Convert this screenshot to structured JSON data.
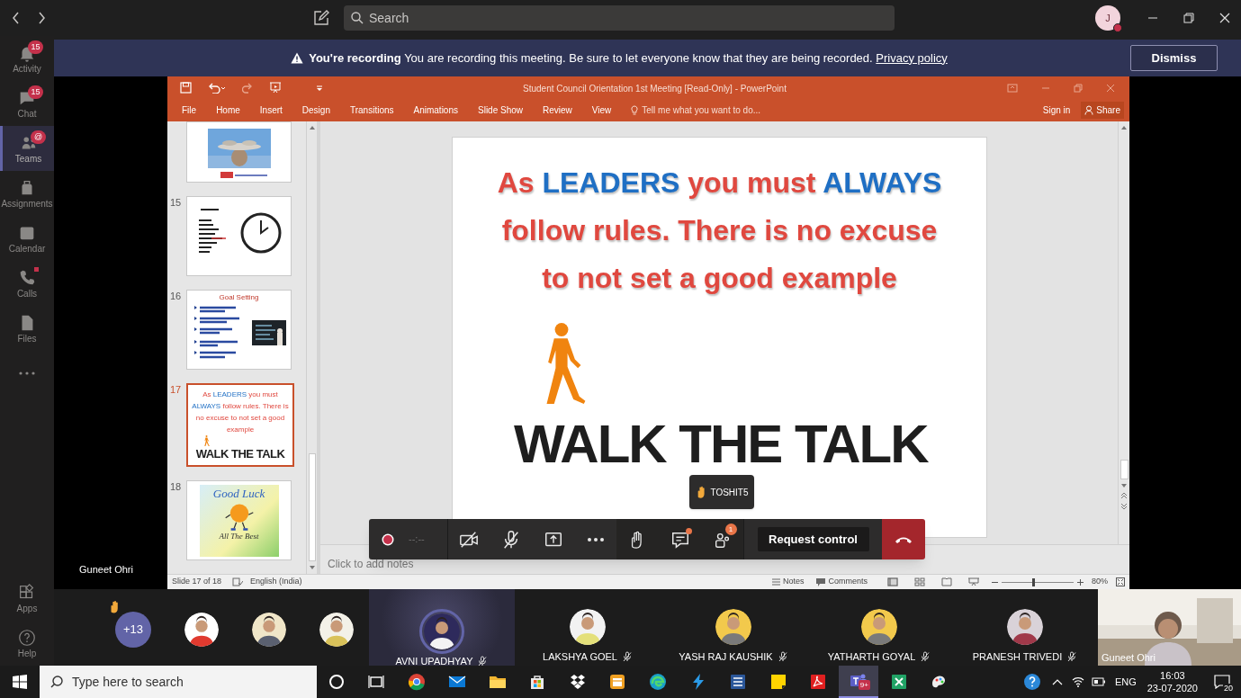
{
  "top_bar": {
    "search_placeholder": "Search",
    "account_initial": "J"
  },
  "app_bar": [
    {
      "kind": "activity",
      "label": "Activity",
      "badge": "15",
      "selected": false,
      "dot": false
    },
    {
      "kind": "chat",
      "label": "Chat",
      "badge": "15",
      "selected": false,
      "dot": false
    },
    {
      "kind": "teams",
      "label": "Teams",
      "badge": "@",
      "selected": true,
      "dot": false
    },
    {
      "kind": "assignments",
      "label": "Assignments",
      "selected": false,
      "dot": false
    },
    {
      "kind": "calendar",
      "label": "Calendar",
      "selected": false,
      "dot": false
    },
    {
      "kind": "calls",
      "label": "Calls",
      "selected": false,
      "dot": true
    },
    {
      "kind": "files",
      "label": "Files",
      "selected": false,
      "dot": false
    }
  ],
  "app_bar_bottom": [
    {
      "kind": "apps",
      "label": "Apps"
    },
    {
      "kind": "help",
      "label": "Help"
    }
  ],
  "banner": {
    "title": "You're recording",
    "message": "You are recording this meeting. Be sure to let everyone know that they are being recorded.",
    "link": "Privacy policy",
    "button": "Dismiss"
  },
  "powerpoint": {
    "title": "Student Council Orientation 1st Meeting [Read-Only] - PowerPoint",
    "ribbon_tabs": [
      "File",
      "Home",
      "Insert",
      "Design",
      "Transitions",
      "Animations",
      "Slide Show",
      "Review",
      "View"
    ],
    "tell_me": "Tell me what you want to do...",
    "sign_in": "Sign in",
    "share": "Share",
    "thumbnails": [
      {
        "kind": "picture",
        "selected": false
      },
      {
        "kind": "clock",
        "number": "15",
        "selected": false
      },
      {
        "kind": "bullets",
        "number": "16",
        "title": "Goal Setting",
        "selected": false
      },
      {
        "kind": "headline",
        "number": "17",
        "segments": [
          {
            "text": "As ",
            "emphasis": false
          },
          {
            "text": "LEADERS",
            "emphasis": true
          },
          {
            "text": " you must ",
            "emphasis": false
          },
          {
            "text": "ALWAYS",
            "emphasis": true
          },
          {
            "text": " follow rules. There is no excuse to not set a good example",
            "emphasis": false
          }
        ],
        "footer": "WALK THE TALK",
        "selected": true
      },
      {
        "kind": "good_luck",
        "number": "18",
        "title": "Good Luck",
        "caption": "All The Best",
        "selected": false
      }
    ],
    "slide": {
      "segments": [
        {
          "text": "As ",
          "emphasis": false
        },
        {
          "text": "LEADERS",
          "emphasis": true
        },
        {
          "text": " you must ",
          "emphasis": false
        },
        {
          "text": "ALWAYS",
          "emphasis": true
        },
        {
          "text": " follow rules. There is no excuse to not set a good example",
          "emphasis": false
        }
      ],
      "footer": "WALK THE TALK"
    },
    "notes_placeholder": "Click to add notes",
    "status": {
      "slide": "Slide 17 of 18",
      "language": "English (India)",
      "notes": "Notes",
      "comments": "Comments",
      "zoom": "80%",
      "level": 0.42
    }
  },
  "presenter_label": "Guneet Ohri",
  "tooltip": {
    "name": "TOSHIT5"
  },
  "call_controls": {
    "timer": "--:--",
    "chat_unread": true,
    "participants_badge": "1",
    "request_control": "Request control"
  },
  "participants": {
    "overflow": "+13",
    "hand_raised": true,
    "avatars": [
      {
        "kind": "picture"
      },
      {
        "kind": "picture"
      },
      {
        "kind": "picture"
      }
    ],
    "tiles": [
      {
        "name": "AVNI UPADHYAY",
        "muted": true,
        "speaking": true
      },
      {
        "name": "LAKSHYA GOEL",
        "muted": true,
        "speaking": false
      },
      {
        "name": "YASH RAJ KAUSHIK",
        "muted": true,
        "speaking": false
      },
      {
        "name": "YATHARTH GOYAL",
        "muted": true,
        "speaking": false
      },
      {
        "name": "PRANESH TRIVEDI",
        "muted": true,
        "speaking": false
      }
    ],
    "self_view": {
      "name": "Guneet Ohri"
    }
  },
  "taskbar": {
    "search_placeholder": "Type here to search",
    "apps": [
      {
        "kind": "cortana",
        "active": false
      },
      {
        "kind": "task_view",
        "active": false
      },
      {
        "kind": "chrome",
        "active": false
      },
      {
        "kind": "mail",
        "active": false
      },
      {
        "kind": "explorer",
        "active": false
      },
      {
        "kind": "store",
        "active": false
      },
      {
        "kind": "dropbox",
        "active": false
      },
      {
        "kind": "office",
        "active": false
      },
      {
        "kind": "edge",
        "active": false
      },
      {
        "kind": "bolt",
        "active": false
      },
      {
        "kind": "word",
        "active": false
      },
      {
        "kind": "sticky_notes",
        "active": false
      },
      {
        "kind": "acrobat",
        "active": false
      },
      {
        "kind": "teams",
        "badge": "9+",
        "active": true
      },
      {
        "kind": "excel",
        "active": false
      },
      {
        "kind": "paint",
        "active": false
      }
    ],
    "language": "ENG",
    "time": "16:03",
    "date": "23-07-2020",
    "notifications": "20"
  }
}
